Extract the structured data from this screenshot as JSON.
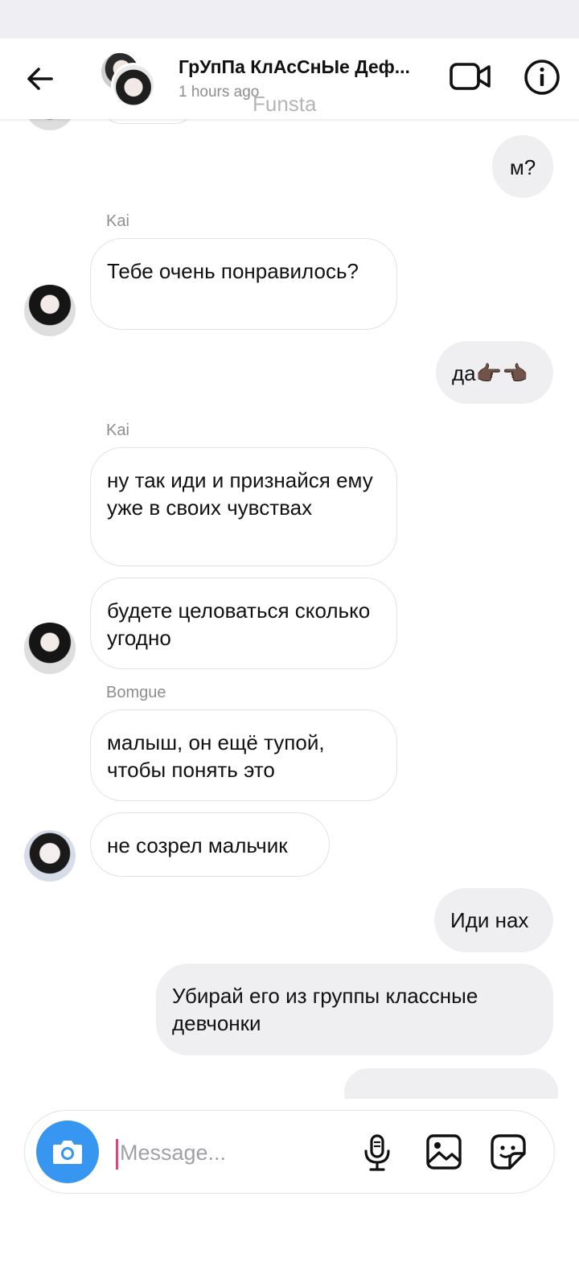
{
  "header": {
    "title": "ГрУпПа КлАсСнЫе Деф...",
    "subtitle": "1 hours ago",
    "watermark": "Funsta"
  },
  "messages": [
    {
      "dir": "out",
      "text": "м?"
    },
    {
      "dir": "in",
      "sender": "Kai",
      "text": "Тебе очень понравилось?"
    },
    {
      "dir": "out",
      "text": "да👉🏿👈🏿"
    },
    {
      "dir": "in",
      "sender": "Kai",
      "text": "ну так иди и признайся ему уже в своих чувствах"
    },
    {
      "dir": "in",
      "text": "будете целоваться сколько угодно"
    },
    {
      "dir": "in",
      "sender": "Bomgue",
      "text": "малыш, он ещё тупой, чтобы понять это"
    },
    {
      "dir": "in",
      "text": "не созрел мальчик"
    },
    {
      "dir": "out",
      "text": "Иди нах"
    },
    {
      "dir": "out",
      "text": "Убирай его из группы классные девчонки"
    }
  ],
  "composer": {
    "placeholder": "Message..."
  },
  "icons": {
    "back": "arrow-left-icon",
    "video": "video-camera-icon",
    "info": "info-icon",
    "camera": "camera-icon",
    "mic": "microphone-icon",
    "gallery": "image-icon",
    "sticker": "sticker-icon"
  },
  "colors": {
    "accent": "#3797f0",
    "cursor": "#e0447a",
    "outgoing_bubble": "#efeff2",
    "incoming_border": "#e2e2e6"
  }
}
